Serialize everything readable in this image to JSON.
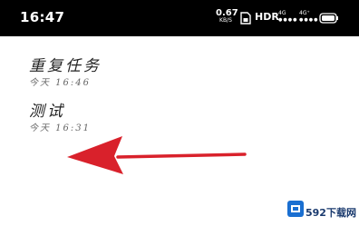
{
  "status_bar": {
    "time": "16:47",
    "net_speed": "0.67",
    "net_speed_unit": "KB/S",
    "hdr": "HDR",
    "network1": "4G",
    "network2": "4G⁺",
    "icons": [
      "sim-card-icon",
      "signal-icon",
      "wifi-icon",
      "battery-icon"
    ]
  },
  "notes": [
    {
      "title": "重复任务",
      "date": "今天 16:46"
    },
    {
      "title": "测试",
      "date": "今天 16:31"
    }
  ],
  "annotation": {
    "color": "#d9212b",
    "direction": "left"
  },
  "watermark": {
    "text": "592下载网",
    "accent": "#1a6fd1"
  }
}
